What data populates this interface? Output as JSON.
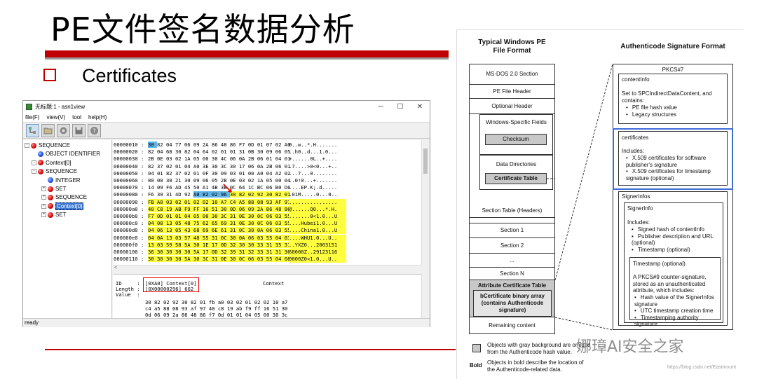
{
  "slide": {
    "title": "PE文件签名数据分析",
    "bullet": "Certificates"
  },
  "window": {
    "title": "无标题:1 - asn1view",
    "controls": [
      "─",
      "☐",
      "✕"
    ],
    "menus": [
      "file(F)",
      "view(V)",
      "tool",
      "help(H)"
    ],
    "toolbar_icons": [
      "tree-view-icon",
      "open-folder-icon",
      "record-icon",
      "save-disk-icon",
      "help-icon"
    ],
    "tree": [
      {
        "label": "SEQUENCE",
        "ball": "red",
        "expander": "-",
        "level": 0
      },
      {
        "label": "OBJECT IDENTIFIER",
        "ball": "blue",
        "expander": "",
        "level": 1
      },
      {
        "label": "Context[0]",
        "ball": "red",
        "expander": "-",
        "level": 1
      },
      {
        "label": "SEQUENCE",
        "ball": "red",
        "expander": "-",
        "level": 2
      },
      {
        "label": "INTEGER",
        "ball": "blue",
        "expander": "",
        "level": 3
      },
      {
        "label": "SET",
        "ball": "red",
        "expander": "+",
        "level": 3
      },
      {
        "label": "SEQUENCE",
        "ball": "red",
        "expander": "+",
        "level": 3
      },
      {
        "label": "Context[0]",
        "ball": "red",
        "expander": "+",
        "level": 3,
        "selected": true
      },
      {
        "label": "SET",
        "ball": "red",
        "expander": "+",
        "level": 3
      }
    ],
    "hex_rows": [
      {
        "addr": "00000010 :",
        "bytes": "30 82 04 77 06 09 2A 86 48 86 F7 0D 01 07 02 A0",
        "ascii": "0..w..*.H.......",
        "hl": "partial1"
      },
      {
        "addr": "00000020 :",
        "bytes": "82 04 68 30 82 04 64 02 01 01 31 0B 30 09 06 05",
        "ascii": "..h0..d...1.0...",
        "hl": "none"
      },
      {
        "addr": "00000030 :",
        "bytes": "2B 0E 03 02 1A 05 00 30 4C 06 0A 2B 06 01 04 01",
        "ascii": "+......0L..+....",
        "hl": "none"
      },
      {
        "addr": "00000040 :",
        "bytes": "82 37 02 01 04 A0 3E 30 3C 30 17 06 0A 2B 06 01",
        "ascii": ".7....>0<0...+..",
        "hl": "none"
      },
      {
        "addr": "00000050 :",
        "bytes": "04 01 82 37 02 01 0F 30 09 03 01 00 A0 04 A2 02",
        "ascii": "...7...0........",
        "hl": "none"
      },
      {
        "addr": "00000060 :",
        "bytes": "80 00 30 21 30 09 06 05 2B 0E 03 02 1A 05 00 04",
        "ascii": "..0!0...+.......",
        "hl": "none"
      },
      {
        "addr": "00000070 :",
        "bytes": "14 09 F6 AD 45 50 A1 4B 3B 0C 64 1C BC 06 B0 D6",
        "ascii": "....EP.K;.d.....",
        "hl": "none"
      },
      {
        "addr": "00000080 :",
        "bytes": "F6 30 31 4D 92 A0 82 02 96 30 82 02 92 30 82 01",
        "ascii": ".01M.....0...0..",
        "hl": "partial8"
      },
      {
        "addr": "00000090 :",
        "bytes": "FB A0 03 02 01 02 02 10 A7 C4 A5 88 08 93 AF 97",
        "ascii": "................",
        "hl": "full"
      },
      {
        "addr": "000000a0 :",
        "bytes": "40 C8 19 AB F9 FF 16 51 30 0D 06 09 2A 86 48 86",
        "ascii": "@......Q0...*.H.",
        "hl": "full"
      },
      {
        "addr": "000000b0 :",
        "bytes": "F7 0D 01 01 04 05 00 30 3C 31 0E 30 0C 06 03 55",
        "ascii": ".......0<1.0...U",
        "hl": "full"
      },
      {
        "addr": "000000c0 :",
        "bytes": "04 08 13 05 48 75 62 65 69 31 0E 30 0C 06 03 55",
        "ascii": "....Hubei1.0...U",
        "hl": "full"
      },
      {
        "addr": "000000d0 :",
        "bytes": "04 06 13 05 43 68 69 6E 61 31 0C 30 0A 06 03 55",
        "ascii": "....China1.0...U",
        "hl": "full"
      },
      {
        "addr": "000000e0 :",
        "bytes": "04 0A 13 03 57 48 55 31 0C 30 0A 06 03 55 04 03",
        "ascii": "....WHU1.0...U..",
        "hl": "full"
      },
      {
        "addr": "000000f0 :",
        "bytes": "13 03 59 58 5A 30 1E 17 0D 32 30 30 33 31 35 31",
        "ascii": "..YXZ0...2003151",
        "hl": "full"
      },
      {
        "addr": "00000100 :",
        "bytes": "36 30 30 30 30 5A 17 0D 32 39 31 32 33 31 31 36",
        "ascii": "60000Z..29123116",
        "hl": "full"
      },
      {
        "addr": "00000110 :",
        "bytes": "30 30 30 30 5A 30 3C 31 0E 30 0C 06 03 55 04 08",
        "ascii": "0000Z0<1.0...U..",
        "hl": "full"
      }
    ],
    "hscroll_arrows": "<",
    "detail": {
      "id_label": "ID     :",
      "id_value": "[0XA0] Context[0]",
      "id_right": "Context",
      "len_label": "Length :",
      "len_value": "[0X00000296] 662",
      "value_label": "Value  :",
      "value_lines": [
        "30 82 02 92 30 82 01 fb a0 03 02 01 02 02 10 a7",
        "c4 a5 88 08 93 af 97 40 c8 19 ab f9 ff 16 51 30",
        "0d 06 09 2a 86 48 86 f7 0d 01 01 04 05 00 30 3c"
      ]
    },
    "status": "ready"
  },
  "diagram": {
    "left_heading": "Typical Windows PE\nFile Format",
    "right_heading": "Authenticode Signature Format",
    "pe": {
      "ms_dos": "MS-DOS 2.0 Section",
      "file_header": "PE File Header",
      "optional_header": "Optional Header",
      "windows_specific": "Windows-Specific Fields",
      "checksum": "Checksum",
      "data_directories": "Data Directories",
      "certificate_table": "Certificate Table",
      "section_table": "Section Table (Headers)",
      "section1": "Section 1",
      "section2": "Section 2",
      "ellipsis": "...",
      "sectionN": "Section N",
      "attr_cert_table": "Attribute Certificate Table",
      "bcert": "bCertificate binary array\n(contains Authenticode\nsignature)",
      "remaining": "Remaining content"
    },
    "auth": {
      "pkcs7": "PKCS#7",
      "content_info": "contentInfo",
      "content_desc": "Set to SPCIndirectDataContent, and\ncontains:",
      "content_items": [
        "PE file hash value",
        "Legacy structures"
      ],
      "certificates": "certificates",
      "cert_includes": "Includes:",
      "cert_items": [
        "X.509 certificates for software\npublisher's signature",
        "X.509 certificates for timestamp\nsignature (optional)"
      ],
      "signer_infos": "SignerInfos",
      "signer_info": "SignerInfo",
      "signer_includes": "Includes:",
      "signer_items": [
        "Signed hash of contentInfo",
        "Publisher description and URL\n(optional)",
        "Timestamp (optional)"
      ],
      "timestamp": "Timestamp (optional)",
      "ts_desc": "A PKCS#9 counter-signature,\nstored as an unauthenticated\nattribute, which includes:",
      "ts_items": [
        "Hash value of the SignerInfos\nsignature",
        "UTC timestamp creation time",
        "Timestamping authority\nsignature"
      ]
    },
    "legend": {
      "gray_text": "Objects with gray background are omitted\nfrom the Authenticode hash value.",
      "bold_label": "Bold",
      "bold_text": "Objects in bold describe the location of\nthe Authenticode-related data."
    },
    "watermark": "娜璋AI安全之家",
    "watermark_url": "https://blog.csdn.net/Eastmount"
  }
}
